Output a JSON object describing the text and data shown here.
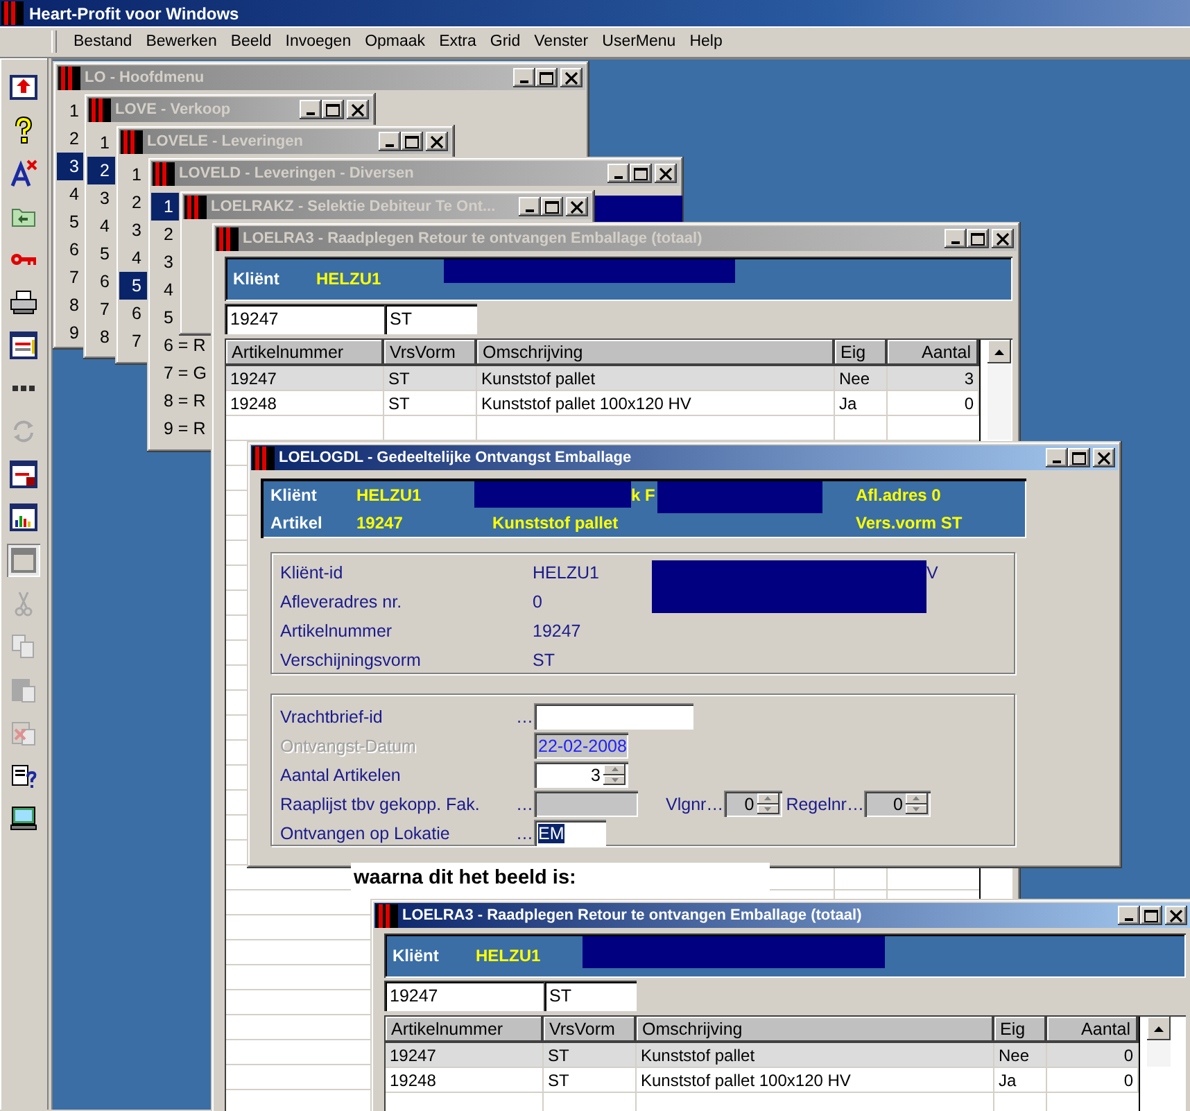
{
  "app": {
    "title": "Heart-Profit voor Windows"
  },
  "menu_bar": [
    "Bestand",
    "Bewerken",
    "Beeld",
    "Invoegen",
    "Opmaak",
    "Extra",
    "Grid",
    "Venster",
    "UserMenu",
    "Help"
  ],
  "toolbar": [
    {
      "kind": "window-arrow",
      "disabled": false,
      "pressed": false
    },
    {
      "kind": "help",
      "disabled": false,
      "pressed": false
    },
    {
      "kind": "font-delete",
      "disabled": false,
      "pressed": false
    },
    {
      "kind": "folder",
      "disabled": false,
      "pressed": false
    },
    {
      "kind": "key",
      "disabled": false,
      "pressed": false
    },
    {
      "kind": "printer",
      "disabled": false,
      "pressed": false
    },
    {
      "kind": "window-list",
      "disabled": false,
      "pressed": false
    },
    {
      "kind": "dots",
      "disabled": false,
      "pressed": false
    },
    {
      "kind": "refresh",
      "disabled": true,
      "pressed": false
    },
    {
      "kind": "window-lock",
      "disabled": false,
      "pressed": false
    },
    {
      "kind": "chart",
      "disabled": false,
      "pressed": false
    },
    {
      "kind": "window",
      "disabled": false,
      "pressed": true
    },
    {
      "kind": "cut",
      "disabled": true,
      "pressed": false
    },
    {
      "kind": "copy",
      "disabled": true,
      "pressed": false
    },
    {
      "kind": "paste",
      "disabled": true,
      "pressed": false
    },
    {
      "kind": "paste-delete",
      "disabled": true,
      "pressed": false
    },
    {
      "kind": "help-props",
      "disabled": false,
      "pressed": false
    },
    {
      "kind": "monitor",
      "disabled": false,
      "pressed": false
    }
  ],
  "windows": [
    {
      "kind": "menu",
      "title": "LO - Hoofdmenu",
      "active": false,
      "items": [
        {
          "label": "1",
          "selected": false
        },
        {
          "label": "2",
          "selected": false
        },
        {
          "label": "3",
          "selected": true
        },
        {
          "label": "4",
          "selected": false
        },
        {
          "label": "5",
          "selected": false
        },
        {
          "label": "6",
          "selected": false
        },
        {
          "label": "7",
          "selected": false
        },
        {
          "label": "8",
          "selected": false
        },
        {
          "label": "9",
          "selected": false
        }
      ]
    },
    {
      "kind": "menu",
      "title": "LOVE - Verkoop",
      "active": false,
      "items": [
        {
          "label": "1",
          "selected": false
        },
        {
          "label": "2",
          "selected": true
        },
        {
          "label": "3",
          "selected": false
        },
        {
          "label": "4",
          "selected": false
        },
        {
          "label": "5",
          "selected": false
        },
        {
          "label": "6",
          "selected": false
        },
        {
          "label": "7",
          "selected": false
        },
        {
          "label": "8",
          "selected": false
        }
      ]
    },
    {
      "kind": "menu",
      "title": "LOVELE - Leveringen",
      "active": false,
      "items": [
        {
          "label": "1",
          "selected": false
        },
        {
          "label": "2",
          "selected": false
        },
        {
          "label": "3",
          "selected": false
        },
        {
          "label": "4",
          "selected": false
        },
        {
          "label": "5",
          "selected": true
        },
        {
          "label": "6",
          "selected": false
        },
        {
          "label": "7",
          "selected": false
        }
      ]
    },
    {
      "kind": "menu",
      "title": "LOVELD - Leveringen - Diversen",
      "active": false,
      "items": [
        {
          "label": "1",
          "selected": true
        },
        {
          "label": "2",
          "selected": false
        },
        {
          "label": "3",
          "selected": false
        },
        {
          "label": "4",
          "selected": false
        },
        {
          "label": "5",
          "selected": false
        },
        {
          "label": "6 = R",
          "selected": false
        },
        {
          "label": "7 = G",
          "selected": false
        },
        {
          "label": "8 = R",
          "selected": false
        },
        {
          "label": "9 = R",
          "selected": false
        }
      ]
    },
    {
      "kind": "blank",
      "title": "LOELRAKZ - Selektie Debiteur Te Ont...",
      "active": false
    },
    {
      "kind": "grid",
      "title": "LOELRA3 - Raadplegen Retour te ontvangen Emballage (totaal)",
      "active": false,
      "band": {
        "label": "Kliënt",
        "value": "HELZU1",
        "redacted": true
      },
      "filters": [
        "19247",
        "ST"
      ],
      "columns": [
        "Artikelnummer",
        "VrsVorm",
        "Omschrijving",
        "Eig",
        "Aantal"
      ],
      "rows": [
        {
          "cells": [
            "19247",
            "ST",
            "Kunststof pallet",
            "Nee",
            "3"
          ],
          "selected": true
        },
        {
          "cells": [
            "19248",
            "ST",
            "Kunststof pallet 100x120 HV",
            "Ja",
            "0"
          ],
          "selected": false
        }
      ]
    },
    {
      "kind": "receipt",
      "title": "LOELOGDL - Gedeeltelijke Ontvangst Emballage",
      "active": true,
      "header_rows": [
        {
          "label": "Kliënt",
          "value": "HELZU1",
          "detail": "k F",
          "extra": "Afl.adres 0",
          "redacted": true
        },
        {
          "label": "Artikel",
          "value": "19247",
          "detail": "Kunststof pallet",
          "extra": "Vers.vorm ST",
          "redacted": false
        }
      ],
      "info_rows": [
        {
          "label": "Kliënt-id",
          "value": "HELZU1",
          "suffix": "V",
          "redacted": true
        },
        {
          "label": "Afleveradres nr.",
          "value": "0",
          "redacted": false
        },
        {
          "label": "Artikelnummer",
          "value": "19247",
          "redacted": false
        },
        {
          "label": "Verschijningsvorm",
          "value": "ST",
          "redacted": false
        }
      ],
      "form_rows": [
        {
          "label": "Vrachtbrief-id",
          "leader": "…",
          "kind": "text",
          "disabled": false,
          "readonly": false,
          "highlighted": false
        },
        {
          "label": "Ontvangst-Datum",
          "kind": "text",
          "value": "22-02-2008",
          "disabled": true,
          "readonly": true,
          "highlighted": false
        },
        {
          "label": "Aantal Artikelen",
          "kind": "spinner",
          "value": "3",
          "disabled": false,
          "readonly": false,
          "highlighted": false
        },
        {
          "label": "Raaplijst tbv gekopp. Fak.",
          "leader": "…",
          "kind": "text",
          "disabled": false,
          "readonly": true,
          "highlighted": false,
          "extras": [
            {
              "label": "Vlgnr…",
              "value": "0"
            },
            {
              "label": "Regelnr…",
              "value": "0"
            }
          ]
        },
        {
          "label": "Ontvangen op Lokatie",
          "leader": "…",
          "kind": "text",
          "value": "EM",
          "disabled": false,
          "readonly": false,
          "highlighted": true
        }
      ]
    },
    {
      "kind": "grid",
      "title": "LOELRA3 - Raadplegen Retour te ontvangen Emballage (totaal)",
      "active": true,
      "band": {
        "label": "Kliënt",
        "value": "HELZU1",
        "redacted": true
      },
      "filters": [
        "19247",
        "ST"
      ],
      "columns": [
        "Artikelnummer",
        "VrsVorm",
        "Omschrijving",
        "Eig",
        "Aantal"
      ],
      "rows": [
        {
          "cells": [
            "19247",
            "ST",
            "Kunststof pallet",
            "Nee",
            "0"
          ],
          "selected": true
        },
        {
          "cells": [
            "19248",
            "ST",
            "Kunststof pallet 100x120 HV",
            "Ja",
            "0"
          ],
          "selected": false
        }
      ]
    }
  ],
  "caption": "waarna dit het beeld is:"
}
